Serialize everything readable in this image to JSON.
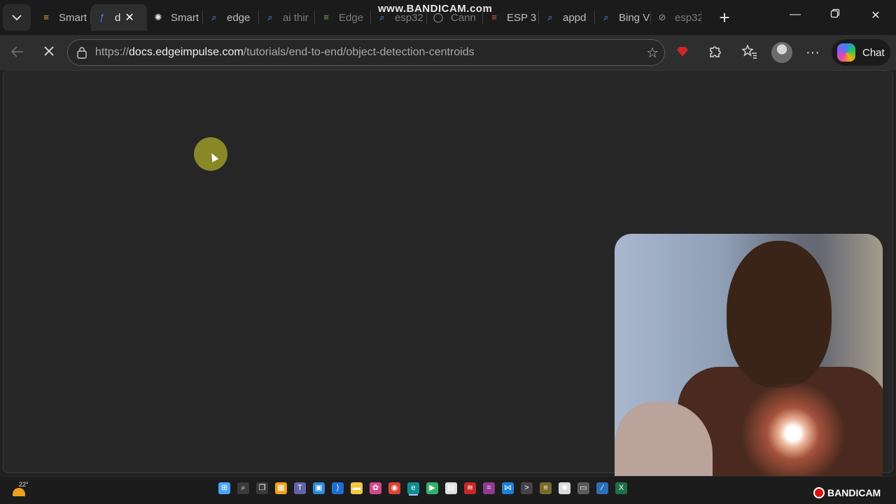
{
  "watermark": "www.BANDICAM.com",
  "tabs": [
    {
      "label": "Smart",
      "icon": "stacked-bars-icon",
      "color": "#e0a23a",
      "active": false,
      "dim": false,
      "width": 80
    },
    {
      "label": "d",
      "icon": "edge-impulse-icon",
      "color": "#3b82f6",
      "active": true,
      "dim": false,
      "width": 80
    },
    {
      "label": "Smart",
      "icon": "openai-icon",
      "color": "#e8e8e8",
      "active": false,
      "dim": false,
      "width": 80
    },
    {
      "label": "edge",
      "icon": "search-icon",
      "color": "#5aa0ff",
      "active": false,
      "dim": false,
      "width": 80
    },
    {
      "label": "ai thir",
      "icon": "search-icon",
      "color": "#5aa0ff",
      "active": false,
      "dim": true,
      "width": 80
    },
    {
      "label": "Edge",
      "icon": "stacked-bars-icon",
      "color": "#6fa84a",
      "active": false,
      "dim": true,
      "width": 80
    },
    {
      "label": "esp32",
      "icon": "search-icon",
      "color": "#5aa0ff",
      "active": false,
      "dim": true,
      "width": 80
    },
    {
      "label": "Cann",
      "icon": "github-icon",
      "color": "#aaaaaa",
      "active": false,
      "dim": true,
      "width": 80
    },
    {
      "label": "ESP 3",
      "icon": "stacked-bars-icon",
      "color": "#d9534f",
      "active": false,
      "dim": false,
      "width": 80
    },
    {
      "label": "appd",
      "icon": "search-icon",
      "color": "#5aa0ff",
      "active": false,
      "dim": false,
      "width": 80
    },
    {
      "label": "Bing V",
      "icon": "search-icon",
      "color": "#5aa0ff",
      "active": false,
      "dim": false,
      "width": 80
    },
    {
      "label": "esp32",
      "icon": "blocked-page-icon",
      "color": "#9a9a9a",
      "active": false,
      "dim": true,
      "width": 72
    }
  ],
  "address": {
    "scheme": "https://",
    "domain": "docs.edgeimpulse.com",
    "path": "/tutorials/end-to-end/object-detection-centroids"
  },
  "toolbar": {
    "chat_label": "Chat"
  },
  "taskbar": {
    "temperature": "22°",
    "icons": [
      {
        "name": "start-icon",
        "color": "#4aa3ff",
        "glyph": "⊞"
      },
      {
        "name": "search-icon",
        "color": "#3a3a3a",
        "glyph": "⌕"
      },
      {
        "name": "task-view-icon",
        "color": "#3a3a3a",
        "glyph": "❐"
      },
      {
        "name": "widgets-icon",
        "color": "#f0a020",
        "glyph": "▦"
      },
      {
        "name": "teams-icon",
        "color": "#6264a7",
        "glyph": "T"
      },
      {
        "name": "store-icon",
        "color": "#2b88d8",
        "glyph": "▣"
      },
      {
        "name": "vscode-alt-icon",
        "color": "#1f6fd1",
        "glyph": "⟩"
      },
      {
        "name": "file-explorer-icon",
        "color": "#f2c744",
        "glyph": "▬"
      },
      {
        "name": "photos-icon",
        "color": "#d04a8a",
        "glyph": "✿"
      },
      {
        "name": "chrome-icon",
        "color": "#db4437",
        "glyph": "◉"
      },
      {
        "name": "edge-icon",
        "color": "#0f8f8f",
        "glyph": "e"
      },
      {
        "name": "play-icon",
        "color": "#2fb36a",
        "glyph": "▶"
      },
      {
        "name": "notepad-icon",
        "color": "#e0e0e0",
        "glyph": "▤"
      },
      {
        "name": "app-red-icon",
        "color": "#c62828",
        "glyph": "≋"
      },
      {
        "name": "app-grid-icon",
        "color": "#8e3b8e",
        "glyph": "⌗"
      },
      {
        "name": "vscode-icon",
        "color": "#1e7fd8",
        "glyph": "⋈"
      },
      {
        "name": "terminal-icon",
        "color": "#444444",
        "glyph": ">"
      },
      {
        "name": "app-stack-icon",
        "color": "#7a6a2a",
        "glyph": "≡"
      },
      {
        "name": "chatgpt-icon",
        "color": "#dcdcdc",
        "glyph": "✺"
      },
      {
        "name": "app-window-icon",
        "color": "#5a5a5a",
        "glyph": "▭"
      },
      {
        "name": "pen-icon",
        "color": "#2c6fb5",
        "glyph": "⁄"
      },
      {
        "name": "excel-icon",
        "color": "#1d7044",
        "glyph": "X"
      }
    ]
  },
  "overlay": {
    "bandicam_label": "BANDICAM"
  }
}
